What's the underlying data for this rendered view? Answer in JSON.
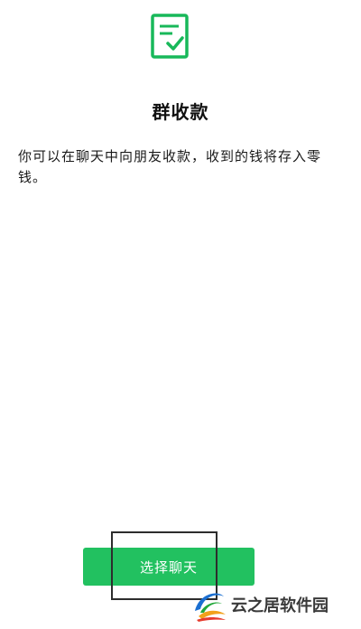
{
  "header": {
    "icon": "receipt-check-icon",
    "title": "群收款"
  },
  "main": {
    "description": "你可以在聊天中向朋友收款，收到的钱将存入零钱。"
  },
  "footer": {
    "button_label": "选择聊天"
  },
  "watermark": {
    "logo": "yunzhiju-logo",
    "text": "云之居软件园"
  },
  "colors": {
    "accent": "#22c160",
    "icon_green": "#18b85a",
    "background": "#ffffff",
    "text": "#111111"
  }
}
